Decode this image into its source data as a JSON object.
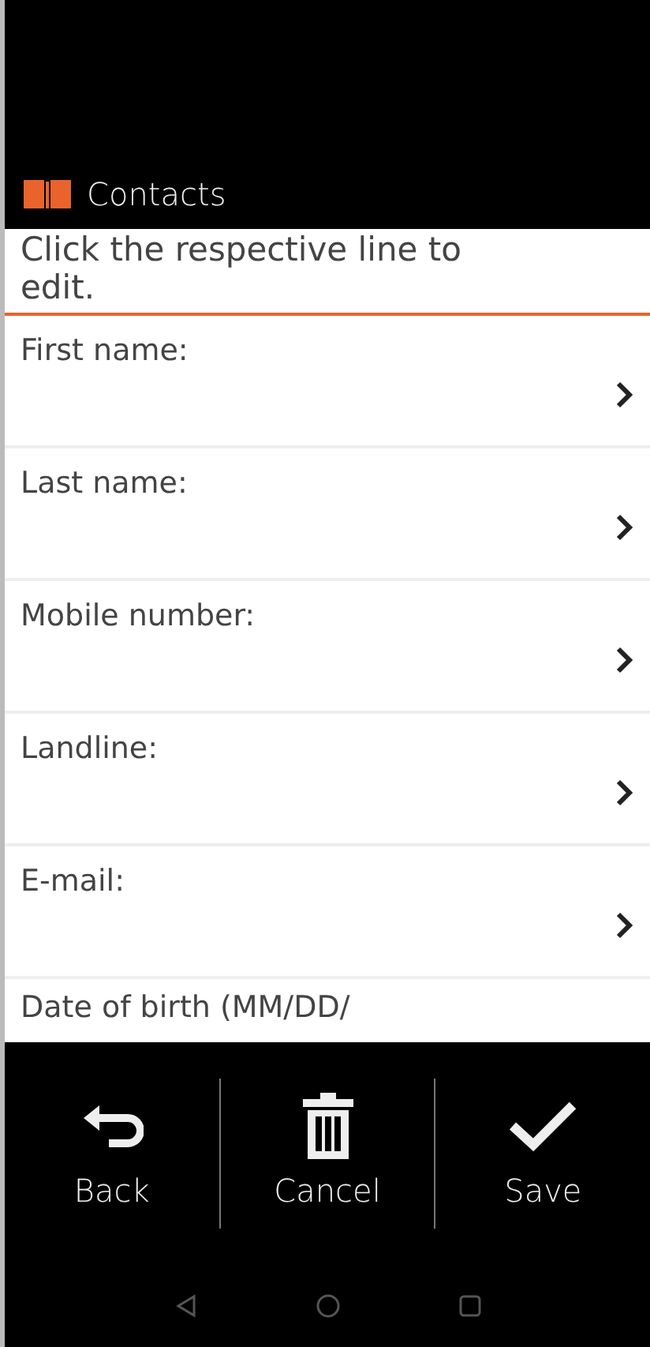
{
  "header": {
    "title": "Contacts"
  },
  "instruction": "Click the respective line to edit.",
  "fields": [
    {
      "label": "First name:"
    },
    {
      "label": "Last name:"
    },
    {
      "label": "Mobile number:"
    },
    {
      "label": "Landline:"
    },
    {
      "label": "E-mail:"
    }
  ],
  "partial_field": {
    "label": "Date of birth (MM/DD/"
  },
  "actions": [
    {
      "kind": "back",
      "label": "Back"
    },
    {
      "kind": "delete",
      "label": "Cancel"
    },
    {
      "kind": "save",
      "label": "Save"
    }
  ]
}
